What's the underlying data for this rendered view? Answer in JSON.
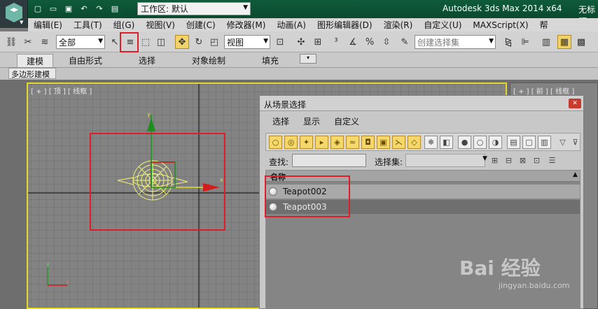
{
  "titlebar": {
    "workspace_label": "工作区: 默认",
    "app_title": "Autodesk 3ds Max  2014 x64",
    "untitled": "无标题"
  },
  "menu": [
    "编辑(E)",
    "工具(T)",
    "组(G)",
    "视图(V)",
    "创建(C)",
    "修改器(M)",
    "动画(A)",
    "图形编辑器(D)",
    "渲染(R)",
    "自定义(U)",
    "MAXScript(X)",
    "帮"
  ],
  "toolbar": {
    "filter_value": "全部",
    "view_value": "视图",
    "named_set_placeholder": "创建选择集"
  },
  "ribbon": {
    "tabs": [
      "建模",
      "自由形式",
      "选择",
      "对象绘制",
      "填充"
    ],
    "sub_tab": "多边形建模"
  },
  "viewport": {
    "label": "[ + ] [ 顶 ] [ 线框 ]",
    "right_label": "[ + ] [ 前 ] [ 线框 ]",
    "axis_x": "x",
    "axis_y": "y"
  },
  "dialog": {
    "title": "从场景选择",
    "menu": [
      "选择",
      "显示",
      "自定义"
    ],
    "find_label": "查找:",
    "set_label": "选择集:",
    "column_header": "名称",
    "rows": [
      {
        "name": "Teapot002",
        "selected": false
      },
      {
        "name": "Teapot003",
        "selected": true
      }
    ]
  },
  "watermark": {
    "text": "Bai  经验",
    "sub": "jingyan.baidu.com"
  },
  "colors": {
    "viewport_border": "#e3d827",
    "annotation": "#e11d2a",
    "titlebar": "#0f5b3a"
  }
}
